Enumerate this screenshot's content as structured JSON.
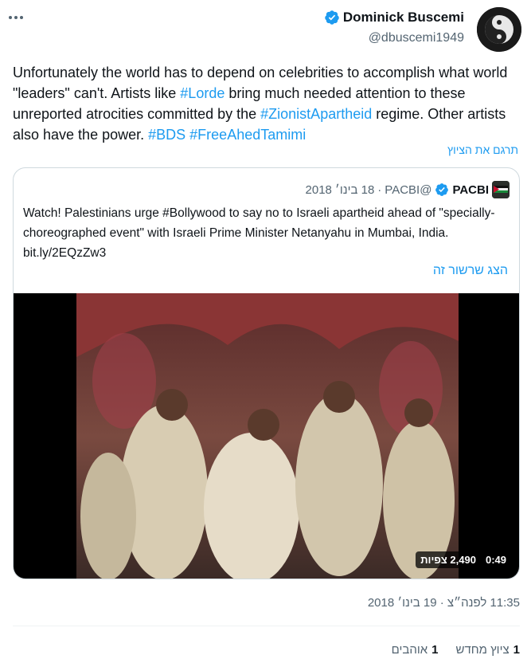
{
  "author": {
    "name": "Dominick Buscemi",
    "handle": "@dbuscemi1949"
  },
  "tweet": {
    "segments": [
      {
        "text": "Unfortunately the world has to depend on celebrities to accomplish what world \"leaders\" can't.  Artists like ",
        "hashtag": false
      },
      {
        "text": "#Lorde",
        "hashtag": true
      },
      {
        "text": " bring much needed attention to these unreported atrocities committed by the ",
        "hashtag": false
      },
      {
        "text": "#ZionistApartheid",
        "hashtag": true
      },
      {
        "text": " regime. Other artists also have the power.  ",
        "hashtag": false
      },
      {
        "text": "#BDS",
        "hashtag": true
      },
      {
        "text": " ",
        "hashtag": false
      },
      {
        "text": "#FreeAhedTamimi",
        "hashtag": true
      }
    ],
    "translate_label": "תרגם את הציוץ",
    "timestamp": "11:35 לפנה״צ · 19 בינו׳ 2018"
  },
  "quote": {
    "name": "PACBI",
    "handle": "@PACBI",
    "separator": "·",
    "date": "18 בינו׳ 2018",
    "text": "Watch! Palestinians urge #Bollywood to say no to Israeli apartheid ahead of \"specially-choreographed event\" with Israeli Prime Minister Netanyahu in Mumbai, India. bit.ly/2EQzZw3",
    "show_thread_label": "הצג שרשור זה",
    "video": {
      "duration": "0:49",
      "views": "2,490",
      "views_label": "צפיות"
    }
  },
  "stats": {
    "retweets_count": "1",
    "retweets_label": "ציוץ מחדש",
    "likes_count": "1",
    "likes_label": "אוהבים"
  },
  "colors": {
    "link": "#1d9bf0",
    "secondary": "#536471",
    "border": "#cfd9de"
  },
  "icons": [
    "more-options-icon",
    "verified-badge-icon",
    "palestine-flag-icon"
  ]
}
